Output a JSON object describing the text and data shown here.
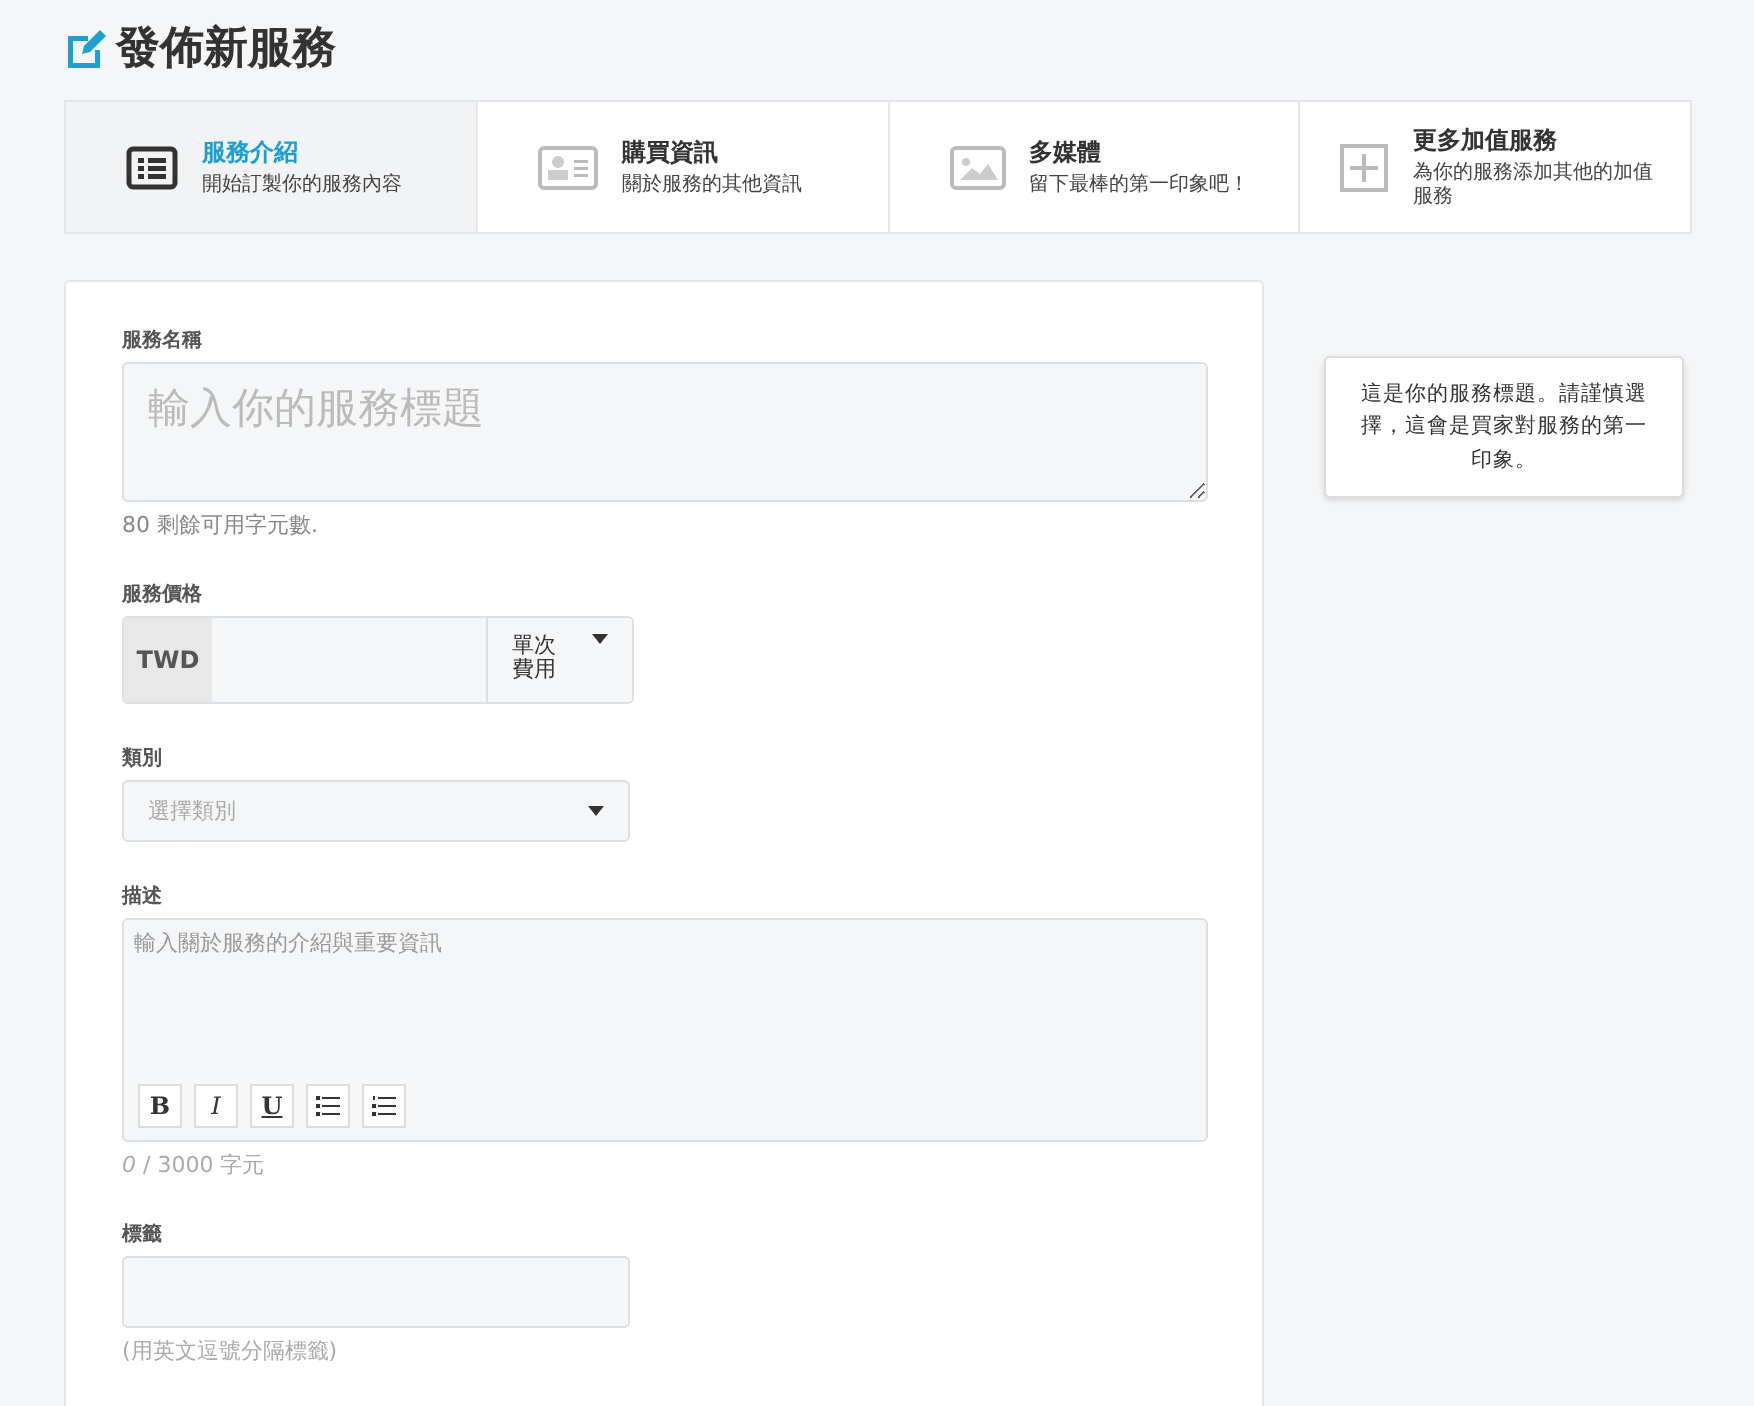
{
  "page_title": "發佈新服務",
  "steps": [
    {
      "kind": "list",
      "title": "服務介紹",
      "subtitle": "開始訂製你的服務內容",
      "selected": true
    },
    {
      "kind": "card",
      "title": "購買資訊",
      "subtitle": "關於服務的其他資訊",
      "selected": false
    },
    {
      "kind": "image",
      "title": "多媒體",
      "subtitle": "留下最棒的第一印象吧！",
      "selected": false
    },
    {
      "kind": "plus",
      "title": "更多加值服務",
      "subtitle": "為你的服務添加其他的加值服務",
      "selected": false
    }
  ],
  "form": {
    "service_name": {
      "label": "服務名稱",
      "placeholder": "輸入你的服務標題",
      "hint": "80 剩餘可用字元數."
    },
    "price": {
      "label": "服務價格",
      "currency": "TWD",
      "billing": "單次費用"
    },
    "category": {
      "label": "類別",
      "placeholder": "選擇類別"
    },
    "description": {
      "label": "描述",
      "placeholder": "輸入關於服務的介紹與重要資訊",
      "toolbar": [
        {
          "kind": "bold",
          "label": "B"
        },
        {
          "kind": "italic",
          "label": "I"
        },
        {
          "kind": "underline",
          "label": "U"
        },
        {
          "kind": "bullets"
        },
        {
          "kind": "numbers"
        }
      ],
      "counter": "*0* / 3000 字元"
    },
    "tags": {
      "label": "標籤",
      "hint": "(用英文逗號分隔標籤)"
    }
  },
  "tooltip": "這是你的服務標題。請謹慎選擇，這會是買家對服務的第一印象。"
}
